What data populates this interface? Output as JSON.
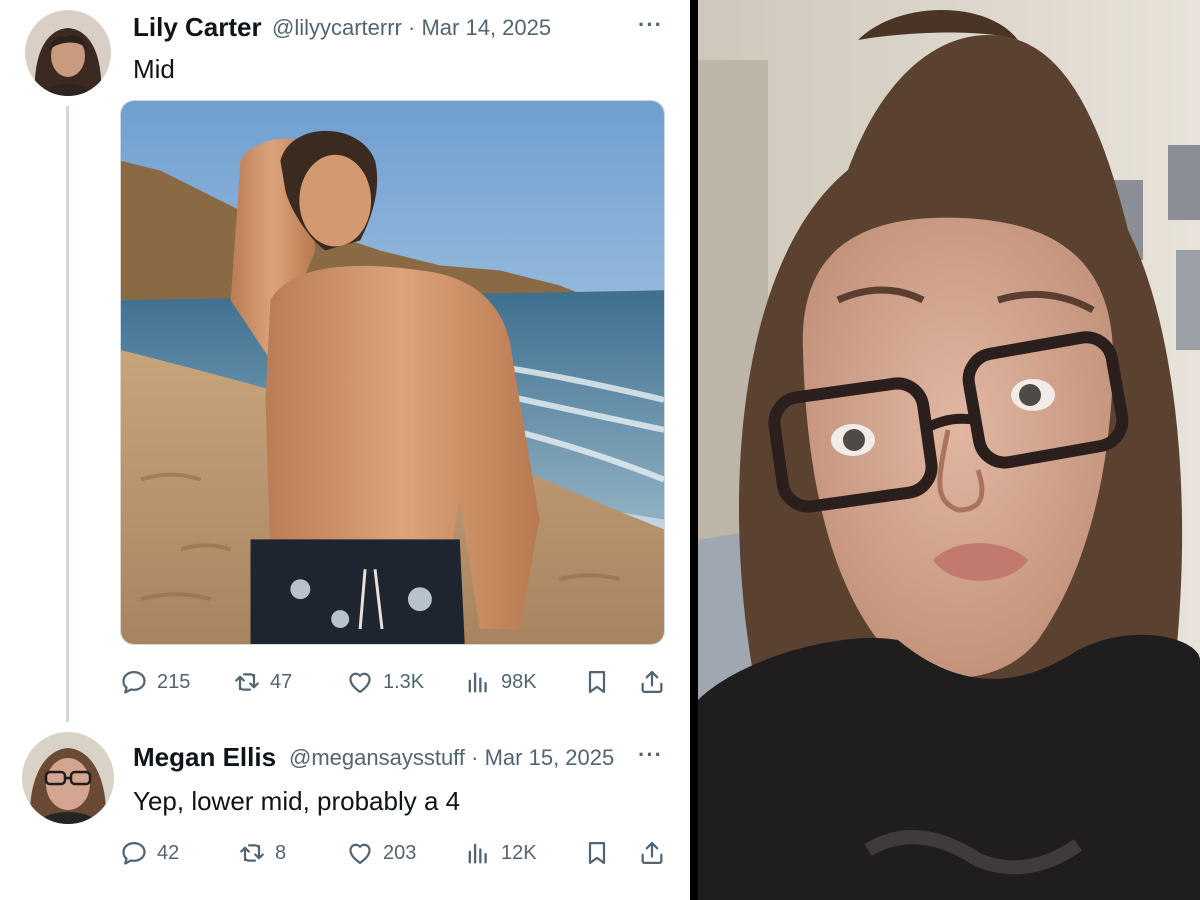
{
  "tweets": [
    {
      "author_name": "Lily Carter",
      "handle": "@lilyycarterrr",
      "separator": "·",
      "date": "Mar 14, 2025",
      "text": "Mid",
      "more_label": "···",
      "has_media": true,
      "media_description_icon": "beach-photo",
      "stats": {
        "replies": "215",
        "reposts": "47",
        "likes": "1.3K",
        "views": "98K"
      }
    },
    {
      "author_name": "Megan Ellis",
      "handle": "@megansaysstuff",
      "separator": "·",
      "date": "Mar 15, 2025",
      "text": "Yep, lower mid, probably a 4",
      "more_label": "···",
      "has_media": false,
      "stats": {
        "replies": "42",
        "reposts": "8",
        "likes": "203",
        "views": "12K"
      }
    }
  ],
  "icons": {
    "reply": "reply-icon",
    "repost": "repost-icon",
    "like": "heart-icon",
    "views": "views-icon",
    "bookmark": "bookmark-icon",
    "share": "share-icon"
  },
  "colors": {
    "text_primary": "#0f1419",
    "text_secondary": "#536471",
    "thread_line": "#cfd9de",
    "background": "#ffffff"
  }
}
